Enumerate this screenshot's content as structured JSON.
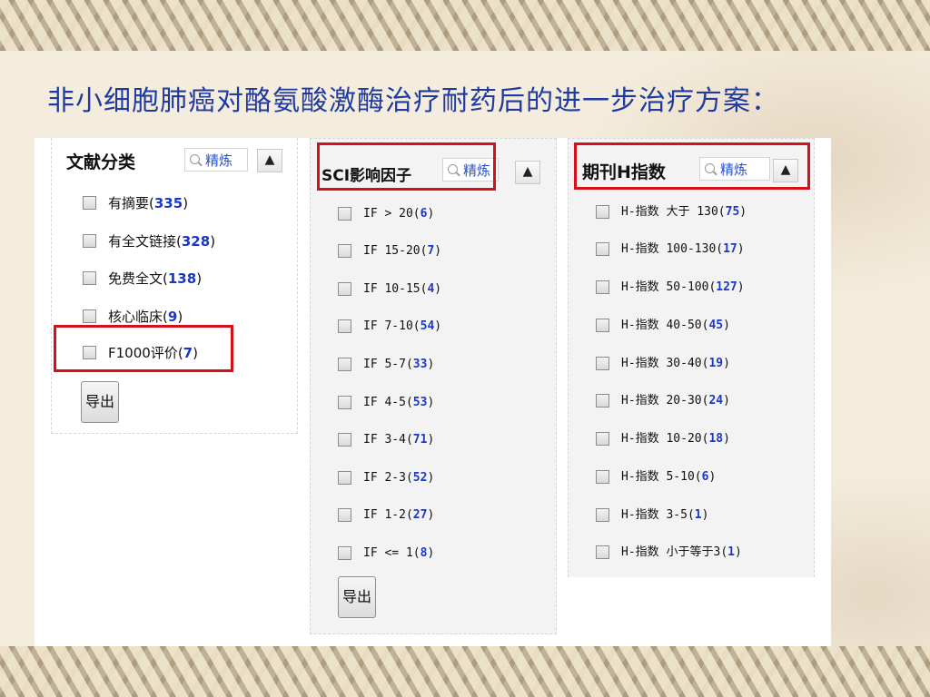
{
  "title": "非小细胞肺癌对酪氨酸激酶治疗耐药后的进一步治疗方案：",
  "panels": {
    "doc": {
      "header": "文献分类",
      "refine": "精炼",
      "collapse_icon": "chevron-up-icon",
      "items": [
        {
          "label": "有摘要",
          "count": "335"
        },
        {
          "label": "有全文链接",
          "count": "328"
        },
        {
          "label": "免费全文",
          "count": "138"
        },
        {
          "label": "核心临床",
          "count": "9"
        },
        {
          "label": "F1000评价",
          "count": "7"
        }
      ],
      "export": "导出"
    },
    "sci": {
      "header": "SCI影响因子",
      "refine": "精炼",
      "items": [
        {
          "label": "IF > 20",
          "count": "6"
        },
        {
          "label": "IF 15-20",
          "count": "7"
        },
        {
          "label": "IF 10-15",
          "count": "4"
        },
        {
          "label": "IF 7-10",
          "count": "54"
        },
        {
          "label": "IF 5-7",
          "count": "33"
        },
        {
          "label": "IF 4-5",
          "count": "53"
        },
        {
          "label": "IF 3-4",
          "count": "71"
        },
        {
          "label": "IF 2-3",
          "count": "52"
        },
        {
          "label": "IF 1-2",
          "count": "27"
        },
        {
          "label": "IF <= 1",
          "count": "8"
        }
      ],
      "export": "导出"
    },
    "hindex": {
      "header": "期刊H指数",
      "refine": "精炼",
      "items": [
        {
          "label": "H-指数 大于 130",
          "count": "75"
        },
        {
          "label": "H-指数 100-130",
          "count": "17"
        },
        {
          "label": "H-指数 50-100",
          "count": "127"
        },
        {
          "label": "H-指数 40-50",
          "count": "45"
        },
        {
          "label": "H-指数 30-40",
          "count": "19"
        },
        {
          "label": "H-指数 20-30",
          "count": "24"
        },
        {
          "label": "H-指数 10-20",
          "count": "18"
        },
        {
          "label": "H-指数 5-10",
          "count": "6"
        },
        {
          "label": "H-指数 3-5",
          "count": "1"
        },
        {
          "label": "H-指数 小于等于3",
          "count": "1"
        }
      ]
    }
  },
  "colors": {
    "title": "#1f3aa0",
    "count": "#1a37c8",
    "highlight": "#d6101a"
  }
}
